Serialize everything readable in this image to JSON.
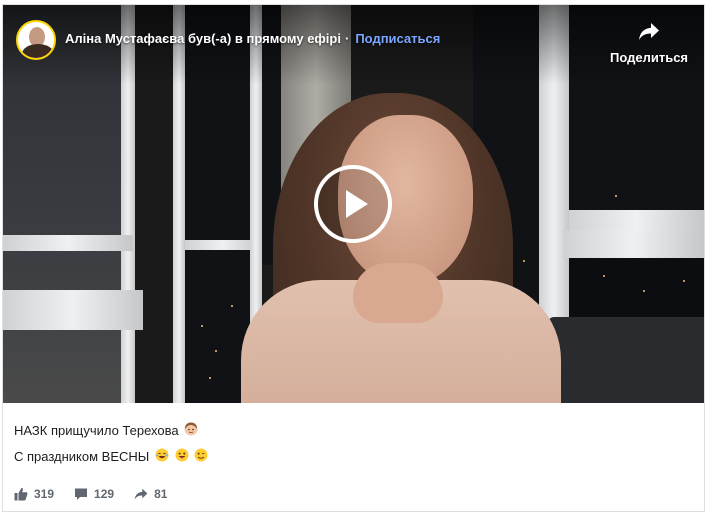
{
  "post": {
    "author_name": "Аліна Мустафаєва",
    "live_status": "був(-а) в прямому ефірі",
    "separator": "·",
    "subscribe_label": "Подписаться",
    "share_label": "Поделиться"
  },
  "caption": {
    "line1": "НАЗК прищучило Терехова",
    "line2": "С праздником ВЕСНЫ"
  },
  "stats": {
    "likes": "319",
    "comments": "129",
    "shares": "81"
  },
  "icons": {
    "share": "share-arrow-icon",
    "play": "play-icon",
    "like": "thumbs-up-icon",
    "comment": "comment-icon",
    "shares": "share-arrow-icon"
  },
  "colors": {
    "subscribe_link": "#7aa7ff",
    "stat_text": "#606770",
    "avatar_ring": "#ffd400"
  }
}
